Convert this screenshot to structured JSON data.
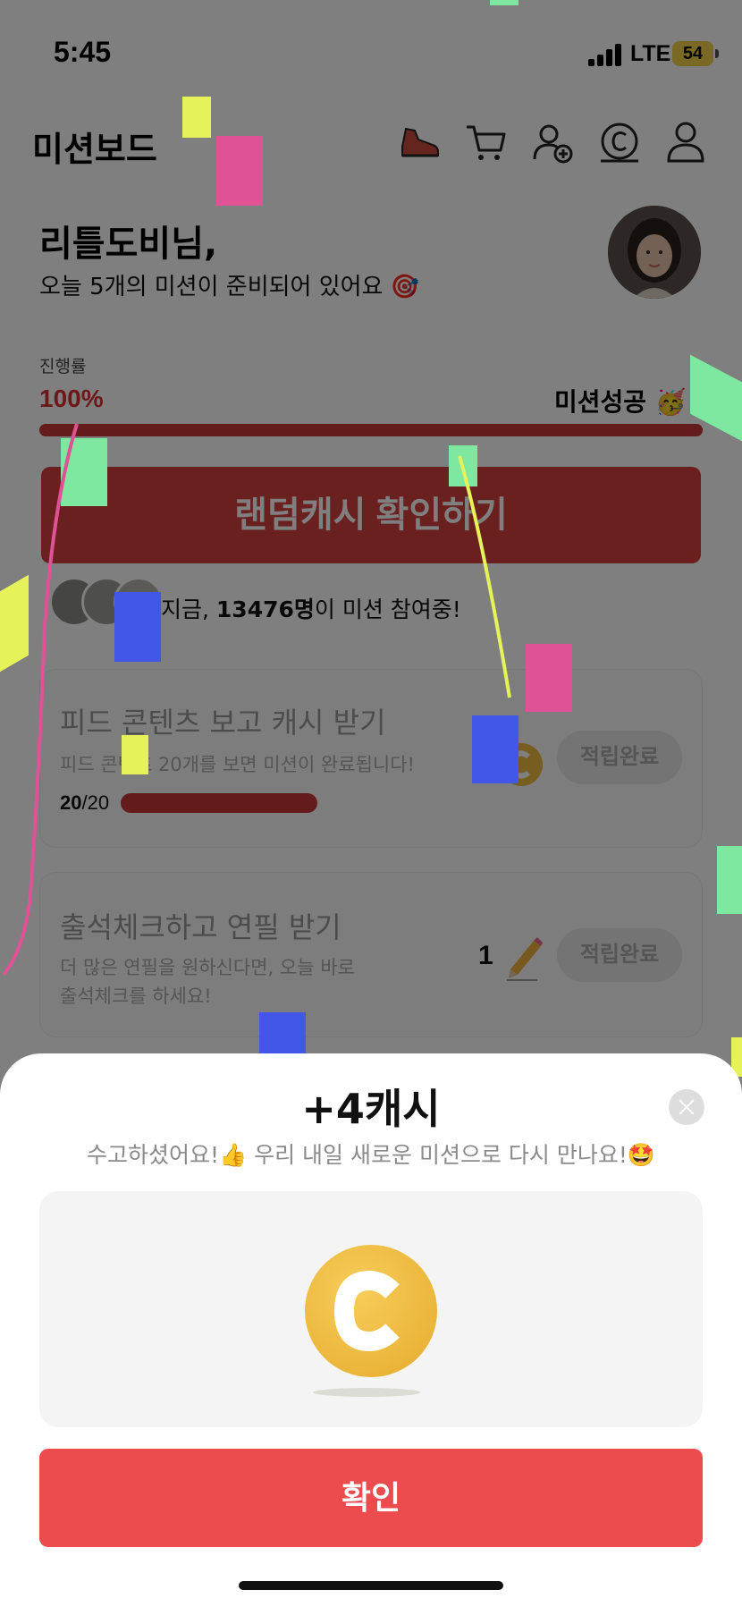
{
  "status_bar": {
    "time": "5:45",
    "network": "LTE",
    "battery": "54"
  },
  "header": {
    "title": "미션보드",
    "icons": [
      "shoe-icon",
      "cart-icon",
      "add-friend-icon",
      "cash-coin-icon",
      "profile-icon"
    ]
  },
  "greeting": {
    "name": "리틀도비님,",
    "subtitle": "오늘 5개의 미션이 준비되어 있어요 🎯"
  },
  "progress": {
    "label": "진행률",
    "value_text": "100%",
    "value": 1.0,
    "status": "미션성공 🥳"
  },
  "random_cash_button": "랜덤캐시 확인하기",
  "participants": {
    "prefix": "지금,",
    "count": "13476명",
    "suffix": "이 미션 참여중!"
  },
  "missions": [
    {
      "title": "피드 콘텐츠 보고 캐시 받기",
      "desc": "피드 콘텐츠 20개를 보면 미션이 완료됩니다!",
      "count_done": "20",
      "count_total": "/20",
      "progress": 1.0,
      "reward_label": "적립완료"
    },
    {
      "title": "출석체크하고 연필 받기",
      "desc_line1": "더 많은 연필을 원하신다면, 오늘 바로",
      "desc_line2": "출석체크를 하세요!",
      "reward_num": "1",
      "reward_label": "적립완료"
    }
  ],
  "sheet": {
    "title": "+4캐시",
    "subtitle": "수고하셨어요!👍 우리 내일 새로운 미션으로 다시 만나요!🤩",
    "confirm": "확인"
  },
  "colors": {
    "accent_red": "#ec4c4e",
    "progress_red": "#c73737",
    "coin_gold": "#eebb3e",
    "confetti_green": "#7ee8a0",
    "confetti_yellow": "#e6f25a",
    "confetti_pink": "#e05296",
    "confetti_blue": "#4257e8"
  }
}
